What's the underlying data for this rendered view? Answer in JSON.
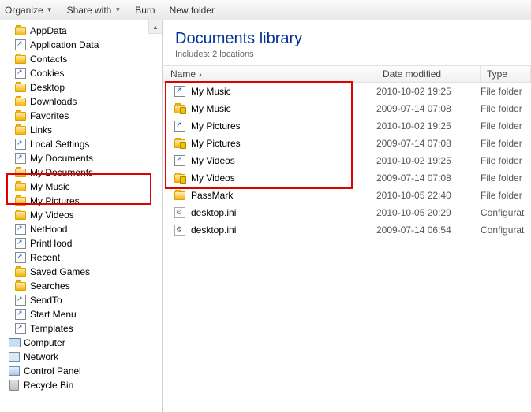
{
  "toolbar": {
    "organize": "Organize",
    "share": "Share with",
    "burn": "Burn",
    "newfolder": "New folder"
  },
  "tree": [
    {
      "icon": "folder",
      "label": "AppData"
    },
    {
      "icon": "link",
      "label": "Application Data"
    },
    {
      "icon": "folder",
      "label": "Contacts"
    },
    {
      "icon": "link",
      "label": "Cookies"
    },
    {
      "icon": "folder",
      "label": "Desktop"
    },
    {
      "icon": "folder",
      "label": "Downloads"
    },
    {
      "icon": "folder",
      "label": "Favorites"
    },
    {
      "icon": "folder",
      "label": "Links"
    },
    {
      "icon": "link",
      "label": "Local Settings"
    },
    {
      "icon": "link",
      "label": "My Documents"
    },
    {
      "icon": "folder",
      "label": "My Documents"
    },
    {
      "icon": "folder",
      "label": "My Music"
    },
    {
      "icon": "folder",
      "label": "My Pictures"
    },
    {
      "icon": "folder",
      "label": "My Videos"
    },
    {
      "icon": "link",
      "label": "NetHood"
    },
    {
      "icon": "link",
      "label": "PrintHood"
    },
    {
      "icon": "link",
      "label": "Recent"
    },
    {
      "icon": "folder",
      "label": "Saved Games"
    },
    {
      "icon": "folder",
      "label": "Searches"
    },
    {
      "icon": "link",
      "label": "SendTo"
    },
    {
      "icon": "link",
      "label": "Start Menu"
    },
    {
      "icon": "link",
      "label": "Templates"
    },
    {
      "icon": "computer",
      "label": "Computer",
      "indent": 0
    },
    {
      "icon": "network",
      "label": "Network",
      "indent": 0
    },
    {
      "icon": "cp",
      "label": "Control Panel",
      "indent": 0
    },
    {
      "icon": "bin",
      "label": "Recycle Bin",
      "indent": 0
    }
  ],
  "library": {
    "title": "Documents library",
    "subtitle": "Includes: 2 locations"
  },
  "columns": {
    "name": "Name",
    "date": "Date modified",
    "type": "Type"
  },
  "files": [
    {
      "icon": "link",
      "name": "My Music",
      "date": "2010-10-02 19:25",
      "type": "File folder"
    },
    {
      "icon": "lockfolder",
      "name": "My Music",
      "date": "2009-07-14 07:08",
      "type": "File folder"
    },
    {
      "icon": "link",
      "name": "My Pictures",
      "date": "2010-10-02 19:25",
      "type": "File folder"
    },
    {
      "icon": "lockfolder",
      "name": "My Pictures",
      "date": "2009-07-14 07:08",
      "type": "File folder"
    },
    {
      "icon": "link",
      "name": "My Videos",
      "date": "2010-10-02 19:25",
      "type": "File folder"
    },
    {
      "icon": "lockfolder",
      "name": "My Videos",
      "date": "2009-07-14 07:08",
      "type": "File folder"
    },
    {
      "icon": "folder",
      "name": "PassMark",
      "date": "2010-10-05 22:40",
      "type": "File folder"
    },
    {
      "icon": "ini",
      "name": "desktop.ini",
      "date": "2010-10-05 20:29",
      "type": "Configurat"
    },
    {
      "icon": "ini",
      "name": "desktop.ini",
      "date": "2009-07-14 06:54",
      "type": "Configurat"
    }
  ]
}
